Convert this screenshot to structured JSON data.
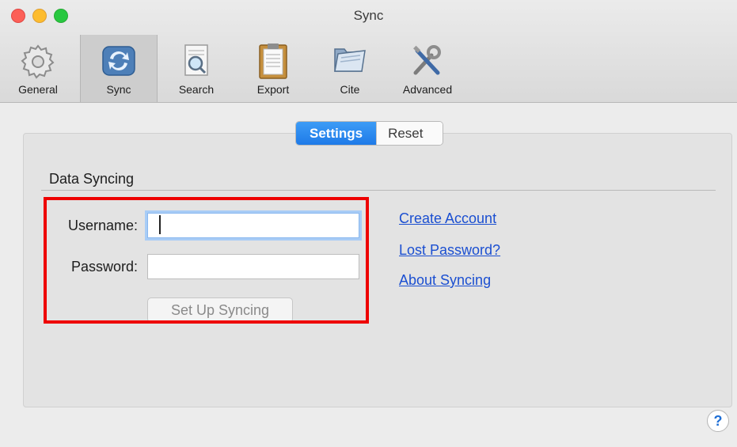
{
  "window": {
    "title": "Sync"
  },
  "toolbar": {
    "items": [
      {
        "label": "General",
        "icon": "gear-icon"
      },
      {
        "label": "Sync",
        "icon": "sync-icon",
        "selected": true
      },
      {
        "label": "Search",
        "icon": "search-icon"
      },
      {
        "label": "Export",
        "icon": "clipboard-icon"
      },
      {
        "label": "Cite",
        "icon": "folder-icon"
      },
      {
        "label": "Advanced",
        "icon": "tools-icon"
      }
    ]
  },
  "tabs": {
    "settings": "Settings",
    "reset": "Reset",
    "active": "Settings"
  },
  "data_syncing": {
    "heading": "Data Syncing",
    "username_label": "Username:",
    "username_value": "",
    "password_label": "Password:",
    "password_value": "",
    "setup_button": "Set Up Syncing"
  },
  "links": {
    "create_account": "Create Account",
    "lost_password": "Lost Password?",
    "about_syncing": "About Syncing"
  },
  "help": {
    "label": "?"
  },
  "colors": {
    "accent": "#1e7ae8",
    "link": "#1b4fd1",
    "highlight_box": "#ee0000"
  }
}
